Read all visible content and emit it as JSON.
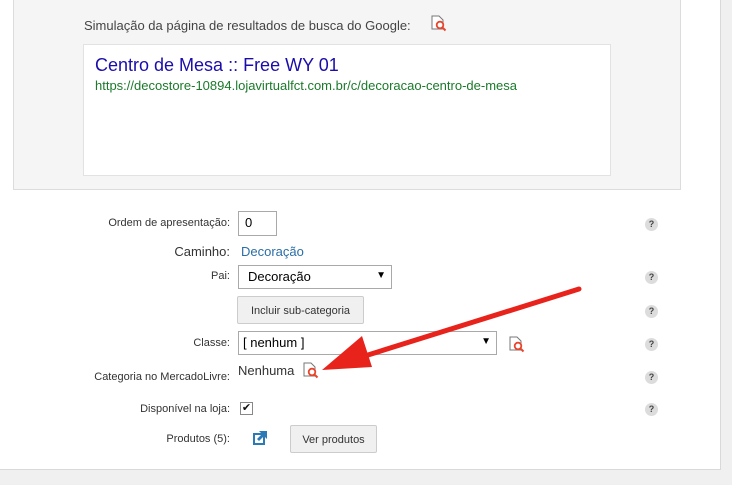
{
  "serp": {
    "title": "Simulação da página de resultados de busca do Google:",
    "result_title": "Centro de Mesa :: Free WY 01",
    "result_url": "https://decostore-10894.lojavirtualfct.com.br/c/decoracao-centro-de-mesa"
  },
  "form": {
    "ordem_label": "Ordem de apresentação:",
    "ordem_value": "0",
    "caminho_label": "Caminho:",
    "caminho_value": "Decoração",
    "pai_label": "Pai:",
    "pai_value": "Decoração",
    "incluir_button": "Incluir sub-categoria",
    "classe_label": "Classe:",
    "classe_value": "[ nenhum ]",
    "ml_label": "Categoria no MercadoLivre:",
    "ml_value": "Nenhuma",
    "disponivel_label": "Disponível na loja:",
    "disponivel_checked": true,
    "produtos_label": "Produtos (5):",
    "ver_produtos_button": "Ver produtos"
  },
  "help_glyph": "?",
  "colors": {
    "arrow": "#e8231c",
    "link": "#1a0dab",
    "url": "#1a7a2a"
  },
  "icons": [
    "magnifier-document-icon",
    "help-icon",
    "external-link-icon",
    "checkbox-check-icon",
    "select-caret-icon"
  ]
}
